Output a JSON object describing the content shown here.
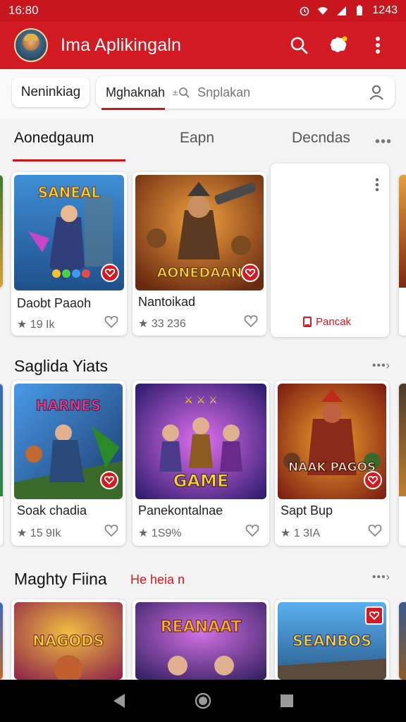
{
  "status": {
    "time": "16:80",
    "right_text": "1243"
  },
  "appbar": {
    "title": "Ima Aplikingaln",
    "icons": [
      "search-icon",
      "notification-icon",
      "more-vert-icon"
    ]
  },
  "search": {
    "chip_label": "Neninkiag",
    "value": "Mghaknah",
    "placeholder": "Snplakan"
  },
  "tabs": {
    "items": [
      "Aonedgaum",
      "Eapn",
      "Decndas"
    ],
    "more": "•••"
  },
  "row1": {
    "cards": [
      {
        "title": "Daobt Paaoh",
        "rating": "★ 19 Ik",
        "art_text": "SANEAL"
      },
      {
        "title": "Nantoikad",
        "rating": "★ 33 236",
        "art_text": "AONEDAAN"
      }
    ],
    "menu_card": {
      "label": "Pancak"
    }
  },
  "section2": {
    "title": "Saglida Yiats",
    "more": "•••›",
    "cards": [
      {
        "title": "Soak chadia",
        "rating": "★ 15 9Ik",
        "art_text": "HARNES"
      },
      {
        "title": "Panekontalnae",
        "rating": "★ 1S9%",
        "art_text": "GAME"
      },
      {
        "title": "Sapt Bup",
        "rating": "★ 1 3IA",
        "art_text": "NAAK PAGOS"
      }
    ]
  },
  "section3": {
    "title": "Maghty Fiina",
    "subtitle": "He heia n",
    "more": "•••›",
    "cards": [
      {
        "art_text": "NAGODS"
      },
      {
        "art_text": "REANAAT"
      },
      {
        "art_text": "SEANBOS"
      }
    ]
  },
  "colors": {
    "brand_red": "#d11a22",
    "status_red": "#c8161e",
    "background": "#f3f3f3"
  }
}
